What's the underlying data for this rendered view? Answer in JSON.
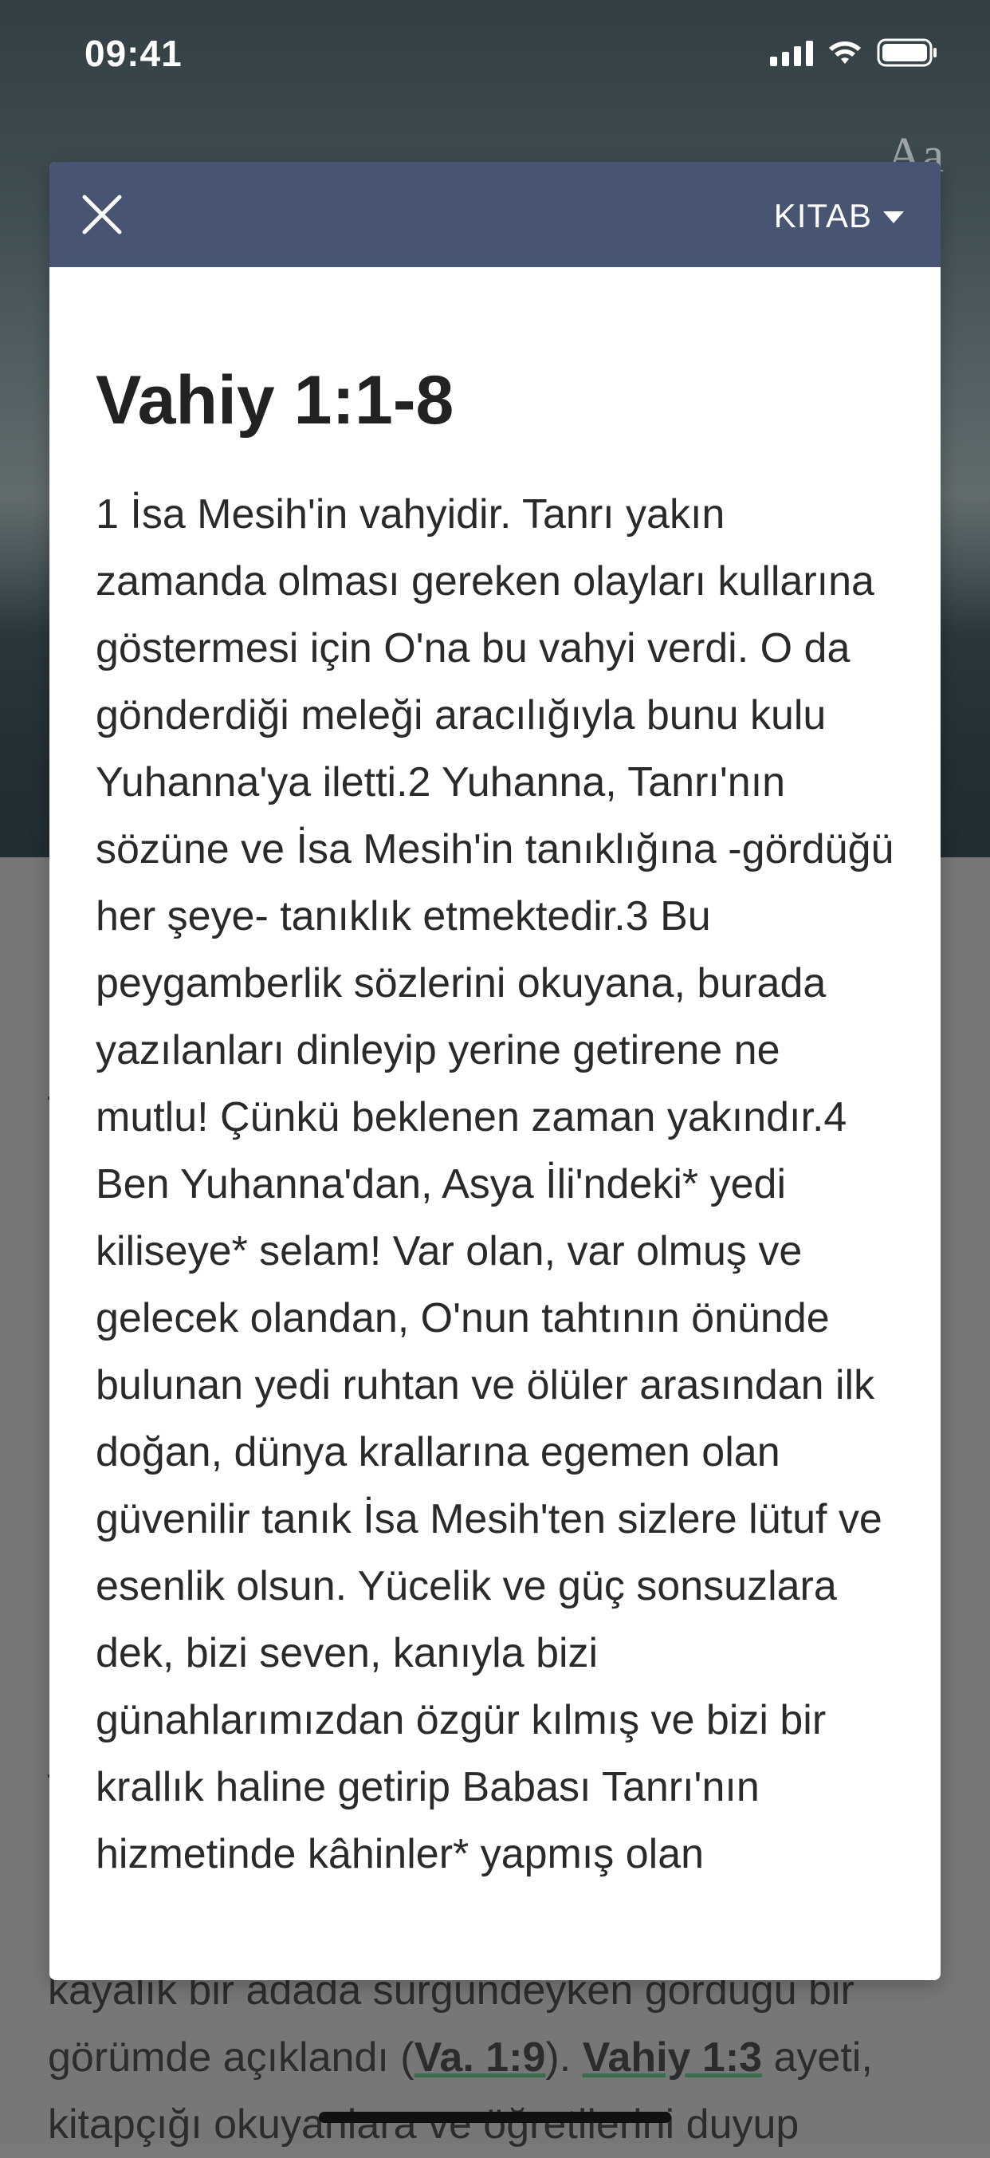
{
  "status_bar": {
    "time": "09:41"
  },
  "modal": {
    "book_selector_label": "KITAB",
    "title": "Vahiy 1:1-8",
    "body": "1 İsa Mesih'in vahyidir. Tanrı yakın zamanda olması gereken olayları kullarına göstermesi için O'na bu vahyi verdi. O da gönderdiği meleği aracılığıyla bunu kulu Yuhanna'ya iletti.2 Yuhanna, Tanrı'nın sözüne ve İsa Mesih'in tanıklığına -gördüğü her şeye- tanıklık etmektedir.3 Bu peygamberlik sözlerini okuyana, burada yazılanları dinleyip yerine getirene ne mutlu! Çünkü beklenen zaman yakındır.4 Ben Yuhanna'dan, Asya İli'ndeki* yedi kiliseye* selam! Var olan, var olmuş ve gelecek olandan, O'nun tahtının önünde bulunan yedi ruhtan ve ölüler arasından ilk doğan, dünya krallarına egemen olan güvenilir tanık İsa Mesih'ten sizlere lütuf ve esenlik olsun. Yücelik ve güç sonsuzlara dek, bizi seven, kanıyla bizi günahlarımızdan özgür kılmış ve bizi bir krallık haline getirip Babası Tanrı'nın hizmetinde kâhinler* yapmış olan"
  },
  "background_article": {
    "line1": "kayalık bir adada sürgündeyken gördüğü bir",
    "line2_a": "görümde açıklandı (",
    "line2_ref1": "Va. 1:9",
    "line2_b": "). ",
    "line2_ref2": "Vahiy 1:3",
    "line2_c": " ayeti,",
    "line3": "kitapçığı okuyanlara ve öğretilerini duyup"
  },
  "colors": {
    "modal_header": "#475573",
    "modal_background": "#ffffff",
    "title_text": "#222222",
    "body_text": "#2a2a2a"
  },
  "icons": {
    "close": "close-icon",
    "book_dropdown": "caret-down-icon",
    "back": "back-arrow-icon",
    "font_size": "font-size-icon"
  }
}
